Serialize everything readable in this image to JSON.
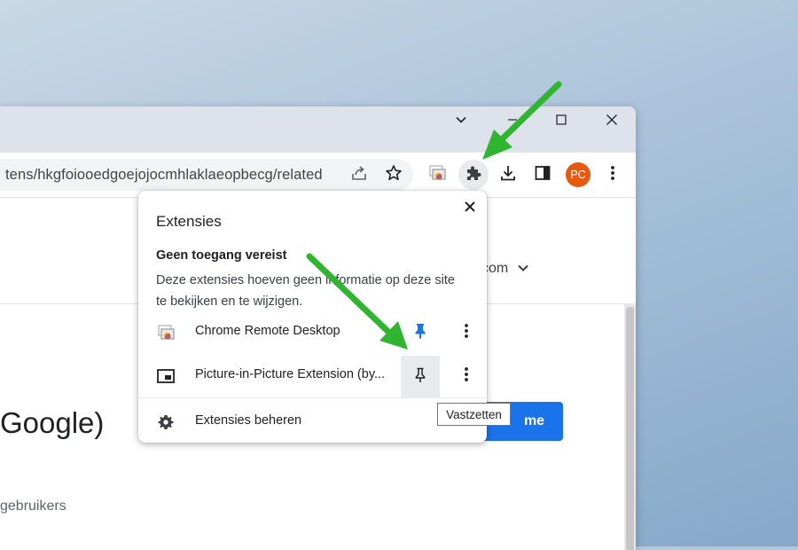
{
  "browser": {
    "url": "tens/hkgfoiooedgoejojocmhlaklaeopbecg/related",
    "profile_initials": "PC",
    "profile_color": "#e8590c"
  },
  "page": {
    "account_text": "com",
    "extension_title": "Google)",
    "users_text": "gebruikers",
    "add_button_label": "me"
  },
  "extensions_popup": {
    "title": "Extensies",
    "section_heading": "Geen toegang vereist",
    "section_description": "Deze extensies hoeven geen informatie op deze site te bekijken en te wijzigen.",
    "items": [
      {
        "name": "Chrome Remote Desktop",
        "pinned": true
      },
      {
        "name": "Picture-in-Picture Extension (by...",
        "pinned": false
      }
    ],
    "manage_label": "Extensies beheren",
    "pin_tooltip": "Vastzetten"
  },
  "colors": {
    "accent_blue": "#1a73e8",
    "arrow_green": "#2fb52f"
  }
}
